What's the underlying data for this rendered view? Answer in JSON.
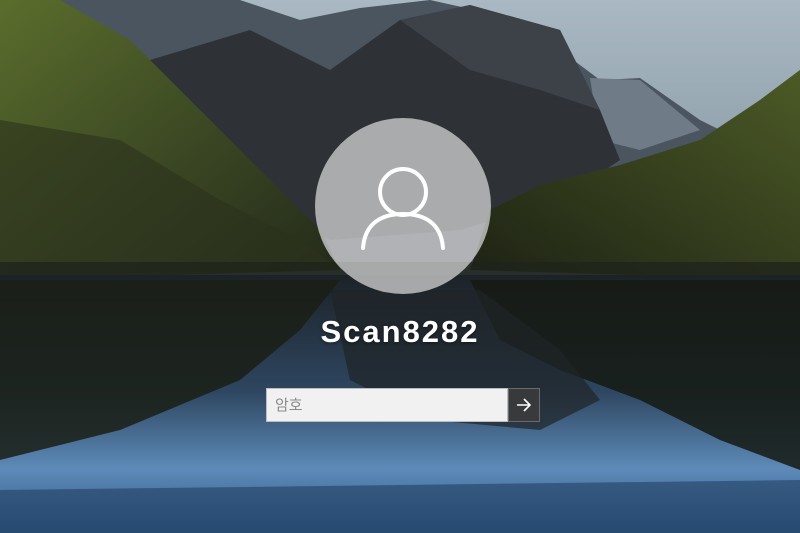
{
  "user": {
    "name": "Scan8282",
    "avatar_icon": "user-silhouette-icon"
  },
  "password": {
    "value": "",
    "placeholder": "암호"
  },
  "submit": {
    "icon": "arrow-right-icon"
  },
  "colors": {
    "avatar_bg": "#cdcdcd",
    "input_bg": "#f1f1f1",
    "submit_bg": "#3c3c3c",
    "username_text": "#ffffff"
  }
}
